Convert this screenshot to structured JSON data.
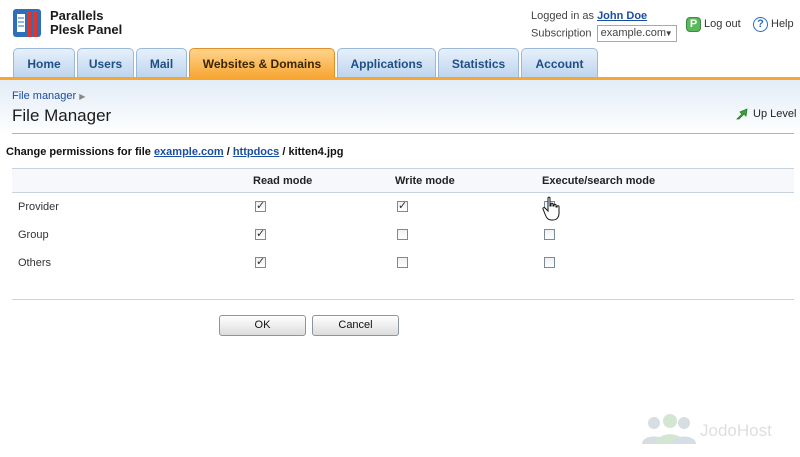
{
  "app": {
    "logo_line1": "Parallels",
    "logo_line2": "Plesk Panel"
  },
  "user": {
    "logged_in_prefix": "Logged in as",
    "name": "John Doe",
    "subscription_label": "Subscription",
    "subscription_value": "example.com"
  },
  "top_links": {
    "logout": "Log out",
    "help": "Help"
  },
  "tabs": [
    {
      "label": "Home",
      "active": false
    },
    {
      "label": "Users",
      "active": false
    },
    {
      "label": "Mail",
      "active": false
    },
    {
      "label": "Websites & Domains",
      "active": true
    },
    {
      "label": "Applications",
      "active": false
    },
    {
      "label": "Statistics",
      "active": false
    },
    {
      "label": "Account",
      "active": false
    }
  ],
  "breadcrumb": "File manager",
  "page_title": "File Manager",
  "up_level": "Up Level",
  "permissions": {
    "title_prefix": "Change permissions for file",
    "path": [
      "example.com",
      "httpdocs"
    ],
    "separator": "/",
    "file": "kitten4.jpg",
    "columns": [
      "",
      "Read mode",
      "Write mode",
      "Execute/search mode"
    ],
    "rows": [
      {
        "name": "Provider",
        "read": true,
        "write": true,
        "execute": false
      },
      {
        "name": "Group",
        "read": true,
        "write": false,
        "execute": false
      },
      {
        "name": "Others",
        "read": true,
        "write": false,
        "execute": false
      }
    ]
  },
  "buttons": {
    "ok": "OK",
    "cancel": "Cancel"
  },
  "watermark": "JodoHost",
  "colors": {
    "active_tab": "#f7a632",
    "tab": "#bcd4ee",
    "link": "#1a4ea0"
  }
}
